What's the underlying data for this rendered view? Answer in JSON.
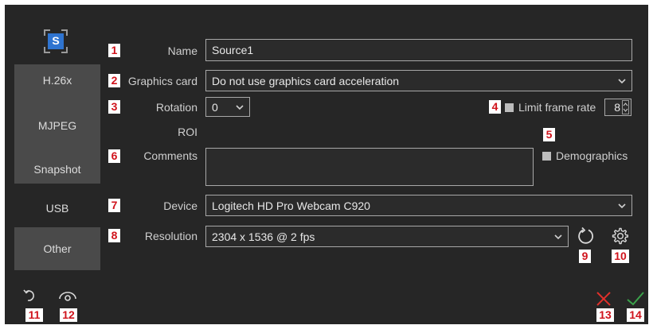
{
  "app": {
    "logo_letter": "S"
  },
  "sidebar": {
    "group1": [
      "H.26x",
      "MJPEG",
      "Snapshot"
    ],
    "usb_label": "USB",
    "other_label": "Other"
  },
  "badges": [
    "1",
    "2",
    "3",
    "4",
    "5",
    "6",
    "7",
    "8",
    "9",
    "10",
    "11",
    "12",
    "13",
    "14"
  ],
  "form": {
    "name_label": "Name",
    "name_value": "Source1",
    "graphics_label": "Graphics card",
    "graphics_value": "Do not use graphics card acceleration",
    "rotation_label": "Rotation",
    "rotation_value": "0",
    "limit_label": "Limit frame rate",
    "limit_value": "8",
    "roi_label": "ROI",
    "comments_label": "Comments",
    "comments_value": "",
    "demographics_label": "Demographics",
    "device_label": "Device",
    "device_value": "Logitech HD Pro Webcam C920",
    "resolution_label": "Resolution",
    "resolution_value": "2304 x 1536 @ 2 fps"
  },
  "icons": {
    "refresh": "refresh-icon",
    "settings": "gear-icon",
    "undo": "undo-icon",
    "preview": "eye-icon",
    "cancel": "close-icon",
    "confirm": "check-icon"
  },
  "colors": {
    "background": "#262626",
    "badge_text": "#d0131c",
    "logo": "#2f74d0",
    "cancel": "#e0302b",
    "confirm": "#3aa14a"
  }
}
